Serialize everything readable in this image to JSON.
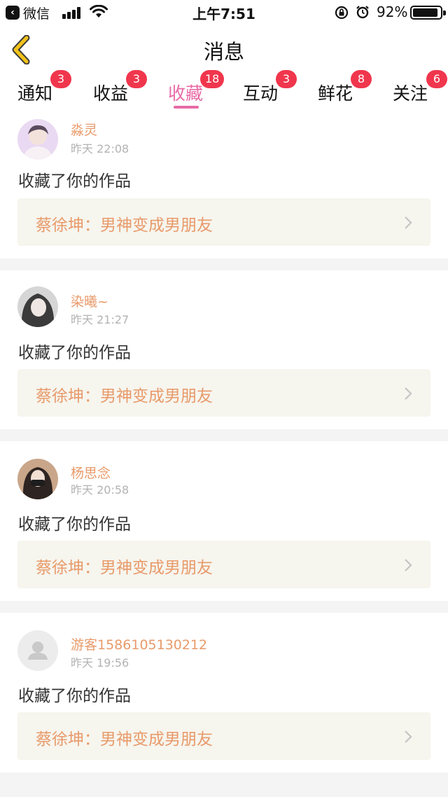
{
  "status_bar": {
    "back_app": "微信",
    "time": "上午7:51",
    "battery_percent": "92%",
    "battery_level": 0.92
  },
  "nav": {
    "title": "消息",
    "back_icon": "chevron-left-icon"
  },
  "tabs": [
    {
      "label": "通知",
      "badge": "3",
      "active": false
    },
    {
      "label": "收益",
      "badge": "3",
      "active": false
    },
    {
      "label": "收藏",
      "badge": "18",
      "active": true
    },
    {
      "label": "互动",
      "badge": "3",
      "active": false
    },
    {
      "label": "鲜花",
      "badge": "8",
      "active": false
    },
    {
      "label": "关注",
      "badge": "6",
      "active": false
    }
  ],
  "messages": [
    {
      "user": "淼灵",
      "time": "昨天 22:08",
      "action": "收藏了你的作品",
      "work": "蔡徐坤：男神变成男朋友"
    },
    {
      "user": "染曦~",
      "time": "昨天 21:27",
      "action": "收藏了你的作品",
      "work": "蔡徐坤：男神变成男朋友"
    },
    {
      "user": "杨思念",
      "time": "昨天 20:58",
      "action": "收藏了你的作品",
      "work": "蔡徐坤：男神变成男朋友"
    },
    {
      "user": "游客1586105130212",
      "time": "昨天 19:56",
      "action": "收藏了你的作品",
      "work": "蔡徐坤：男神变成男朋友"
    }
  ],
  "colors": {
    "accent_pink": "#e86aa6",
    "badge_red": "#f0364d",
    "name_orange": "#e89a6a",
    "back_yellow": "#f2c21a"
  }
}
